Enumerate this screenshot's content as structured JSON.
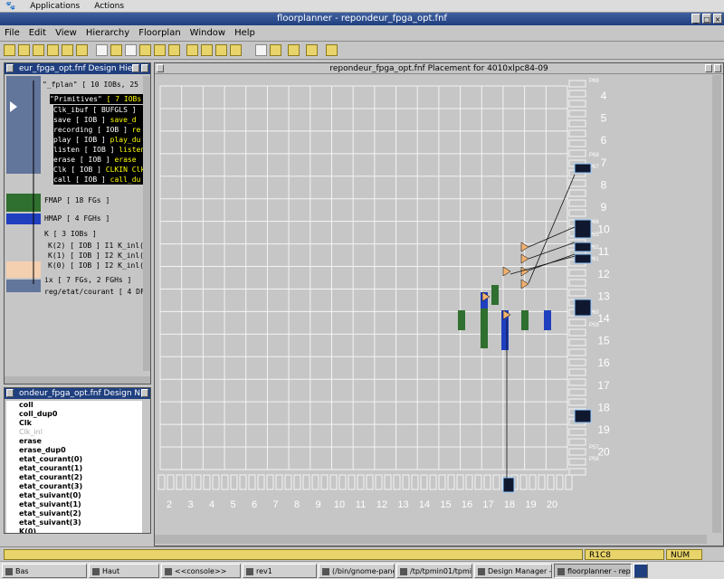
{
  "gnome_panel": {
    "applications": "Applications",
    "actions": "Actions"
  },
  "window": {
    "title": "floorplanner - repondeur_fpga_opt.fnf"
  },
  "menu": [
    "File",
    "Edit",
    "View",
    "Hierarchy",
    "Floorplan",
    "Window",
    "Help"
  ],
  "hierarchy_pane": {
    "title": "eur_fpga_opt.fnf Design Hier",
    "rows": [
      {
        "text": "\"_fplan\"",
        "tag": "[ 10 IOBs, 25 FGs, 6",
        "inverted": false
      },
      {
        "text": "\"Primitives\"",
        "tag": "[ 7 IOBs 1",
        "inverted": true
      },
      {
        "text": "Clk_ibuf [ BUFGLS ]",
        "tag": "",
        "inverted": true
      },
      {
        "text": "save [ IOB ]",
        "tag": "save_d",
        "inverted": true
      },
      {
        "text": "recording [ IOB ]",
        "tag": "re",
        "inverted": true
      },
      {
        "text": "play [ IOB ]",
        "tag": "play_du",
        "inverted": true
      },
      {
        "text": "listen [ IOB ]",
        "tag": "listen",
        "inverted": true
      },
      {
        "text": "erase [ IOB ]",
        "tag": "erase",
        "inverted": true
      },
      {
        "text": "Clk [ IOB ]",
        "tag": "CLKIN Clk",
        "inverted": true
      },
      {
        "text": "call [ IOB ]",
        "tag": "call_du",
        "inverted": true
      },
      {
        "text": "FMAP",
        "tag": "[ 18 FGs ]",
        "inverted": false
      },
      {
        "text": "HMAP",
        "tag": "[ 4 FGHs ]",
        "inverted": false
      },
      {
        "text": "K",
        "tag": "[ 3 IOBs ]",
        "inverted": false
      },
      {
        "text": "K(2) [ IOB ]",
        "tag": "I1 K_inl(2)",
        "inverted": false
      },
      {
        "text": "K(1) [ IOB ]",
        "tag": "I2 K_inl(1)",
        "inverted": false
      },
      {
        "text": "K(0) [ IOB ]",
        "tag": "I2 K_inl(0)",
        "inverted": false
      },
      {
        "text": "ix",
        "tag": "[ 7 FGs, 2 FGHs ]",
        "inverted": false
      },
      {
        "text": "reg/etat/courant",
        "tag": "[ 4 DF",
        "inverted": false
      }
    ]
  },
  "names_pane": {
    "title": "ondeur_fpga_opt.fnf Design N",
    "items": [
      "coll",
      "coll_dup0",
      "Clk",
      "Clk_inl",
      "erase",
      "erase_dup0",
      "etat_courant(0)",
      "etat_courant(1)",
      "etat_courant(2)",
      "etat_courant(3)",
      "etat_suivant(0)",
      "etat_suivant(1)",
      "etat_suivant(2)",
      "etat_suivant(3)",
      "K(0)"
    ]
  },
  "placement": {
    "title": "repondeur_fpga_opt.fnf Placement for 4010xlpc84-09",
    "row_labels": [
      "4",
      "5",
      "6",
      "7",
      "8",
      "9",
      "10",
      "11",
      "12",
      "13",
      "14",
      "15",
      "16",
      "17",
      "18",
      "19",
      "20"
    ],
    "col_labels": [
      "2",
      "3",
      "4",
      "5",
      "6",
      "7",
      "8",
      "9",
      "10",
      "11",
      "12",
      "13",
      "14",
      "15",
      "16",
      "17",
      "18",
      "19",
      "20"
    ],
    "pin_labels": [
      "P69",
      "P68",
      "P67",
      "P66",
      "P65",
      "P62",
      "P61",
      "P60",
      "P59",
      "P57",
      "P56"
    ]
  },
  "status": {
    "coord": "R1C8",
    "num": "NUM"
  },
  "taskbar": [
    "Bas",
    "Haut",
    "<<console>>",
    "rev1",
    "(/bin/gnome-panel--",
    "/tp/tpmin01/tpminf01/Tl",
    "Design Manager - n",
    "floorplanner - repon"
  ],
  "colors": {
    "title_bg": "#1f3f7f",
    "grid_line": "#ffffff",
    "clb_green": "#2f6f2f",
    "clb_blue": "#1f3fbf",
    "iob_orange": "#f0b070",
    "status_yellow": "#e8d46a"
  }
}
